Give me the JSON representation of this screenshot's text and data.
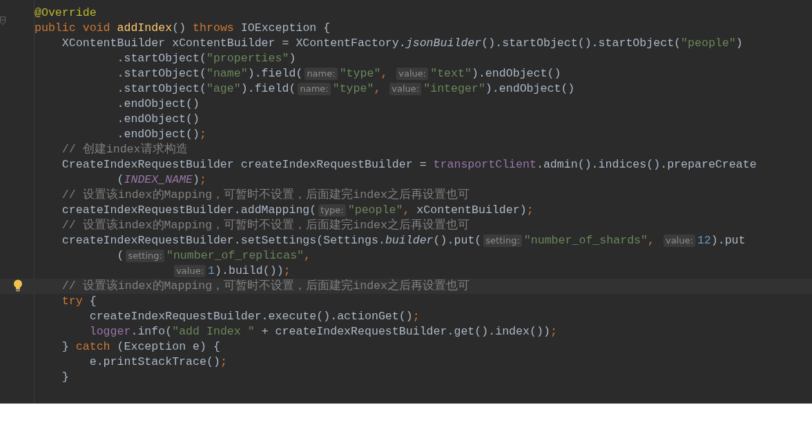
{
  "editor": {
    "lines": [
      {
        "tokens": [
          {
            "kind": "annotation",
            "text": "@Override"
          }
        ]
      },
      {
        "fold": true,
        "tokens": [
          {
            "kind": "keyword",
            "text": "public void "
          },
          {
            "kind": "declaration",
            "text": "addIndex"
          },
          {
            "kind": "plain",
            "text": "() "
          },
          {
            "kind": "keyword",
            "text": "throws "
          },
          {
            "kind": "plain",
            "text": "IOException {"
          }
        ]
      },
      {
        "tokens": [
          {
            "kind": "plain",
            "text": "    XContentBuilder xContentBuilder = XContentFactory."
          },
          {
            "kind": "static",
            "text": "jsonBuilder"
          },
          {
            "kind": "plain",
            "text": "().startObject().startObject("
          },
          {
            "kind": "string",
            "text": "\"people\""
          },
          {
            "kind": "plain",
            "text": ")"
          }
        ]
      },
      {
        "tokens": [
          {
            "kind": "plain",
            "text": "            .startObject("
          },
          {
            "kind": "string",
            "text": "\"properties\""
          },
          {
            "kind": "plain",
            "text": ")"
          }
        ]
      },
      {
        "tokens": [
          {
            "kind": "plain",
            "text": "            .startObject("
          },
          {
            "kind": "string",
            "text": "\"name\""
          },
          {
            "kind": "plain",
            "text": ").field("
          },
          {
            "kind": "hint",
            "text": "name:"
          },
          {
            "kind": "string",
            "text": "\"type\""
          },
          {
            "kind": "punct",
            "text": ", "
          },
          {
            "kind": "hint",
            "text": "value:"
          },
          {
            "kind": "string",
            "text": "\"text\""
          },
          {
            "kind": "plain",
            "text": ").endObject()"
          }
        ]
      },
      {
        "tokens": [
          {
            "kind": "plain",
            "text": "            .startObject("
          },
          {
            "kind": "string",
            "text": "\"age\""
          },
          {
            "kind": "plain",
            "text": ").field("
          },
          {
            "kind": "hint",
            "text": "name:"
          },
          {
            "kind": "string",
            "text": "\"type\""
          },
          {
            "kind": "punct",
            "text": ", "
          },
          {
            "kind": "hint",
            "text": "value:"
          },
          {
            "kind": "string",
            "text": "\"integer\""
          },
          {
            "kind": "plain",
            "text": ").endObject()"
          }
        ]
      },
      {
        "tokens": [
          {
            "kind": "plain",
            "text": "            .endObject()"
          }
        ]
      },
      {
        "tokens": [
          {
            "kind": "plain",
            "text": "            .endObject()"
          }
        ]
      },
      {
        "tokens": [
          {
            "kind": "plain",
            "text": "            .endObject()"
          },
          {
            "kind": "punct",
            "text": ";"
          }
        ]
      },
      {
        "tokens": [
          {
            "kind": "comment",
            "text": "    // 创建index请求构造"
          }
        ]
      },
      {
        "tokens": [
          {
            "kind": "plain",
            "text": "    CreateIndexRequestBuilder createIndexRequestBuilder = "
          },
          {
            "kind": "field",
            "text": "transportClient"
          },
          {
            "kind": "plain",
            "text": ".admin().indices().prepareCreate"
          }
        ]
      },
      {
        "tokens": [
          {
            "kind": "plain",
            "text": "            ("
          },
          {
            "kind": "constant",
            "text": "INDEX_NAME"
          },
          {
            "kind": "plain",
            "text": ")"
          },
          {
            "kind": "punct",
            "text": ";"
          }
        ]
      },
      {
        "tokens": [
          {
            "kind": "comment",
            "text": "    // 设置该index的Mapping，可暂时不设置，后面建完index之后再设置也可"
          }
        ]
      },
      {
        "tokens": [
          {
            "kind": "plain",
            "text": "    createIndexRequestBuilder.addMapping("
          },
          {
            "kind": "hint",
            "text": "type:"
          },
          {
            "kind": "string",
            "text": "\"people\""
          },
          {
            "kind": "punct",
            "text": ", "
          },
          {
            "kind": "plain",
            "text": "xContentBuilder)"
          },
          {
            "kind": "punct",
            "text": ";"
          }
        ]
      },
      {
        "tokens": [
          {
            "kind": "comment",
            "text": "    // 设置该index的Mapping，可暂时不设置，后面建完index之后再设置也可"
          }
        ]
      },
      {
        "tokens": [
          {
            "kind": "plain",
            "text": "    createIndexRequestBuilder.setSettings(Settings."
          },
          {
            "kind": "static",
            "text": "builder"
          },
          {
            "kind": "plain",
            "text": "().put("
          },
          {
            "kind": "hint",
            "text": "setting:"
          },
          {
            "kind": "string",
            "text": "\"number_of_shards\""
          },
          {
            "kind": "punct",
            "text": ", "
          },
          {
            "kind": "hint",
            "text": "value:"
          },
          {
            "kind": "number",
            "text": "12"
          },
          {
            "kind": "plain",
            "text": ").put"
          }
        ]
      },
      {
        "tokens": [
          {
            "kind": "plain",
            "text": "            ("
          },
          {
            "kind": "hint",
            "text": "setting:"
          },
          {
            "kind": "string",
            "text": "\"number_of_replicas\""
          },
          {
            "kind": "punct",
            "text": ","
          }
        ]
      },
      {
        "tokens": [
          {
            "kind": "hint",
            "text": "                    value:"
          },
          {
            "kind": "number",
            "text": "1"
          },
          {
            "kind": "plain",
            "text": ").build())"
          },
          {
            "kind": "punct",
            "text": ";"
          }
        ]
      },
      {
        "current": true,
        "bulb": true,
        "tokens": [
          {
            "kind": "comment",
            "text": "    // 设置该index的Mapping，可暂时不设置，后面建完index之后再设置也可"
          }
        ]
      },
      {
        "tokens": [
          {
            "kind": "keyword",
            "text": "    try "
          },
          {
            "kind": "plain",
            "text": "{"
          }
        ]
      },
      {
        "tokens": [
          {
            "kind": "plain",
            "text": "        createIndexRequestBuilder.execute().actionGet()"
          },
          {
            "kind": "punct",
            "text": ";"
          }
        ]
      },
      {
        "tokens": [
          {
            "kind": "field",
            "text": "        logger"
          },
          {
            "kind": "plain",
            "text": ".info("
          },
          {
            "kind": "string",
            "text": "\"add Index \""
          },
          {
            "kind": "plain",
            "text": " + createIndexRequestBuilder.get().index())"
          },
          {
            "kind": "punct",
            "text": ";"
          }
        ]
      },
      {
        "tokens": [
          {
            "kind": "plain",
            "text": "    } "
          },
          {
            "kind": "keyword",
            "text": "catch "
          },
          {
            "kind": "plain",
            "text": "(Exception e) {"
          }
        ]
      },
      {
        "tokens": [
          {
            "kind": "plain",
            "text": "        e.printStackTrace()"
          },
          {
            "kind": "punct",
            "text": ";"
          }
        ]
      },
      {
        "tokens": [
          {
            "kind": "plain",
            "text": "    }"
          }
        ]
      }
    ]
  }
}
